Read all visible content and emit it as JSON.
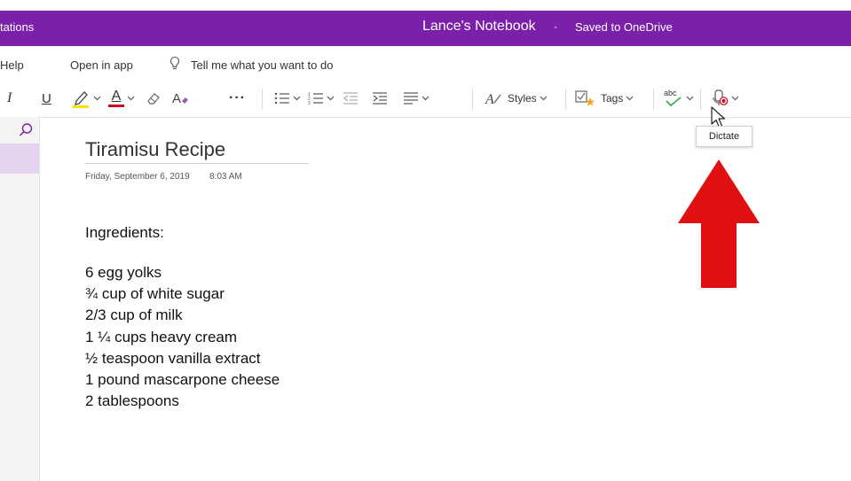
{
  "titlebar": {
    "left_text": "tations",
    "notebook": "Lance's Notebook",
    "separator": "-",
    "status": "Saved to OneDrive",
    "bg_color": "#7b20a8"
  },
  "menubar": {
    "help": "Help",
    "open_in_app": "Open in app",
    "tell_me": "Tell me what you want to do"
  },
  "ribbon": {
    "italic": "I",
    "underline": "U",
    "font_color_letter": "A",
    "font_color": "#d0021b",
    "highlight_color": "#f5e400",
    "more": "···",
    "styles": "Styles",
    "tags": "Tags",
    "spelling": "abc"
  },
  "tooltip": {
    "dictate": "Dictate"
  },
  "page": {
    "title": "Tiramisu Recipe",
    "date": "Friday, September 6, 2019",
    "time": "8:03 AM",
    "heading": "Ingredients:",
    "ingredients": [
      "6 egg yolks",
      "¾ cup of white sugar",
      "2/3 cup of milk",
      "1 ¼ cups heavy cream",
      "½ teaspoon vanilla extract",
      "1 pound mascarpone cheese",
      "2 tablespoons"
    ]
  },
  "annotation": {
    "arrow_color": "#e01010"
  }
}
